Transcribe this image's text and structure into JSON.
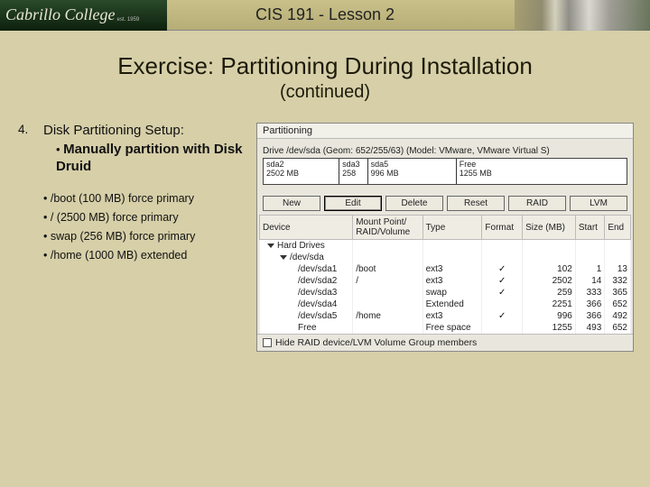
{
  "header": {
    "logo": "Cabrillo College",
    "logo_sub": "est. 1959",
    "title": "CIS 191 - Lesson 2"
  },
  "slide": {
    "title": "Exercise: Partitioning During Installation",
    "subtitle": "(continued)"
  },
  "step": {
    "number": "4.",
    "heading": "Disk Partitioning Setup:",
    "sub_bold": "Manually partition with Disk Druid",
    "items": [
      "/boot (100 MB) force primary",
      "/ (2500 MB) force primary",
      "swap (256 MB) force primary",
      "/home (1000 MB) extended"
    ]
  },
  "partition_window": {
    "title": "Partitioning",
    "drive_label": "Drive /dev/sda (Geom: 652/255/63) (Model: VMware, VMware Virtual S)",
    "map": [
      {
        "name": "sda2",
        "size": "2502 MB"
      },
      {
        "name": "sda3",
        "size": "258"
      },
      {
        "name": "sda5",
        "size": "996 MB"
      },
      {
        "name": "Free",
        "size": "1255 MB"
      }
    ],
    "buttons": [
      "New",
      "Edit",
      "Delete",
      "Reset",
      "RAID",
      "LVM"
    ],
    "columns": [
      "Device",
      "Mount Point/\nRAID/Volume",
      "Type",
      "Format",
      "Size (MB)",
      "Start",
      "End"
    ],
    "rows": [
      {
        "indent": 1,
        "tri": true,
        "device": "Hard Drives",
        "mount": "",
        "type": "",
        "format": "",
        "size": "",
        "start": "",
        "end": ""
      },
      {
        "indent": 2,
        "tri": true,
        "device": "/dev/sda",
        "mount": "",
        "type": "",
        "format": "",
        "size": "",
        "start": "",
        "end": ""
      },
      {
        "indent": 3,
        "tri": false,
        "device": "/dev/sda1",
        "mount": "/boot",
        "type": "ext3",
        "format": "✓",
        "size": "102",
        "start": "1",
        "end": "13"
      },
      {
        "indent": 3,
        "tri": false,
        "device": "/dev/sda2",
        "mount": "/",
        "type": "ext3",
        "format": "✓",
        "size": "2502",
        "start": "14",
        "end": "332"
      },
      {
        "indent": 3,
        "tri": false,
        "device": "/dev/sda3",
        "mount": "",
        "type": "swap",
        "format": "✓",
        "size": "259",
        "start": "333",
        "end": "365"
      },
      {
        "indent": 3,
        "tri": false,
        "device": "/dev/sda4",
        "mount": "",
        "type": "Extended",
        "format": "",
        "size": "2251",
        "start": "366",
        "end": "652"
      },
      {
        "indent": 3,
        "tri": false,
        "device": "/dev/sda5",
        "mount": "/home",
        "type": "ext3",
        "format": "✓",
        "size": "996",
        "start": "366",
        "end": "492"
      },
      {
        "indent": 3,
        "tri": false,
        "device": "Free",
        "mount": "",
        "type": "Free space",
        "format": "",
        "size": "1255",
        "start": "493",
        "end": "652"
      }
    ],
    "footer_checkbox": "Hide RAID device/LVM Volume Group members"
  }
}
